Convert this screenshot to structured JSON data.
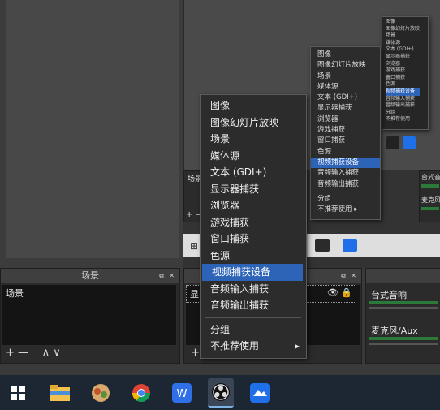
{
  "scenes_dock": {
    "title": "场景",
    "items": [
      "场景"
    ],
    "toolbar": [
      "+",
      "—",
      "∧",
      "∨"
    ]
  },
  "sources_dock": {
    "partial_label": "显",
    "toolbar": [
      "+"
    ]
  },
  "mixer_dock": {
    "tracks": [
      "台式音响",
      "麦克风/Aux"
    ]
  },
  "context_menu": {
    "items": [
      "图像",
      "图像幻灯片放映",
      "场景",
      "媒体源",
      "文本 (GDI+)",
      "显示器捕获",
      "浏览器",
      "游戏捕获",
      "窗口捕获",
      "色源",
      "视频捕获设备",
      "音频输入捕获",
      "音频输出捕获"
    ],
    "selected": "视频捕获设备",
    "group": "分组",
    "deprecated": "不推荐使用"
  },
  "nested_scenes_label": "场景",
  "nested_mixer": [
    "台式音响",
    "麦克风/"
  ],
  "taskbar_apps": [
    "windows-start",
    "file-explorer",
    "photos",
    "chrome",
    "wps",
    "obs",
    "feishu"
  ],
  "colors": {
    "selection": "#2e64b7",
    "taskbar": "#1d2633",
    "panel": "#2b2b2b"
  }
}
